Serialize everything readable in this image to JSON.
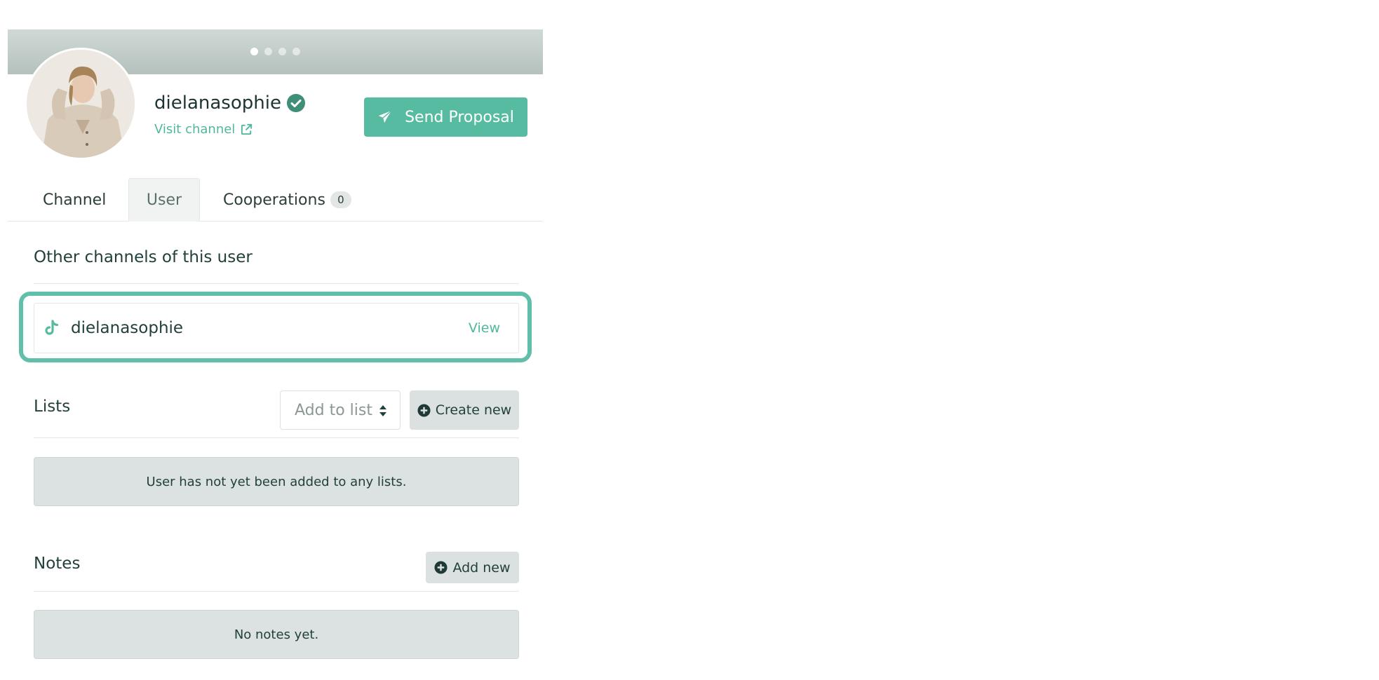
{
  "carousel": {
    "dot_count": 4,
    "active_index": 0
  },
  "profile": {
    "username": "dielanasophie",
    "verified": true,
    "visit_label": "Visit channel",
    "send_proposal_label": "Send Proposal"
  },
  "tabs": [
    {
      "label": "Channel",
      "active": false
    },
    {
      "label": "User",
      "active": true
    },
    {
      "label": "Cooperations",
      "active": false,
      "badge": "0"
    }
  ],
  "other_channels": {
    "title": "Other channels of this user",
    "items": [
      {
        "platform_icon": "tiktok-icon",
        "name": "dielanasophie",
        "action_label": "View"
      }
    ]
  },
  "lists": {
    "title": "Lists",
    "select_placeholder": "Add to list",
    "create_label": "Create new",
    "empty_text": "User has not yet been added to any lists."
  },
  "notes": {
    "title": "Notes",
    "add_label": "Add new",
    "empty_text": "No notes yet."
  },
  "colors": {
    "accent": "#56bba0",
    "highlight_border": "#5fbfa8",
    "link": "#4fb89c",
    "verified_badge": "#3f8e78"
  }
}
